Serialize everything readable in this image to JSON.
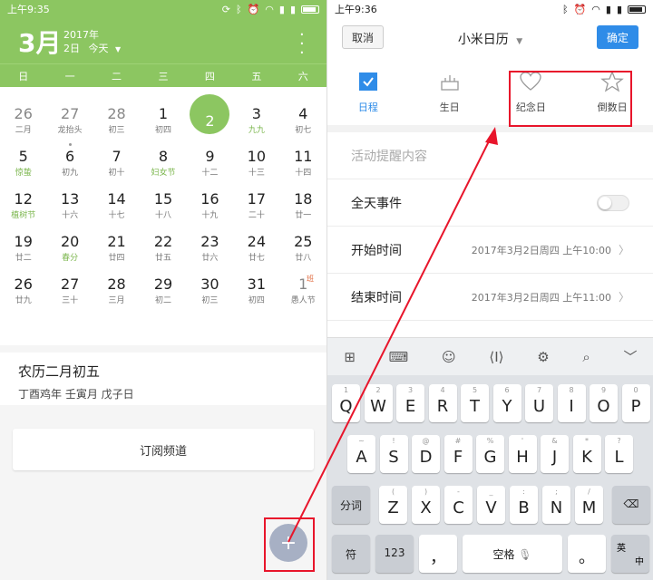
{
  "left": {
    "status": {
      "time": "上午9:35"
    },
    "header": {
      "month": "3月",
      "year": "2017年",
      "day": "2日",
      "today_label": "今天",
      "dropdown_icon": "triangle-down-icon",
      "menu_icon": "more-vertical-icon"
    },
    "weekdays": [
      "日",
      "一",
      "二",
      "三",
      "四",
      "五",
      "六"
    ],
    "days": [
      {
        "n": "26",
        "l": "二月",
        "dim": true
      },
      {
        "n": "27",
        "l": "龙抬头",
        "dim": true
      },
      {
        "n": "28",
        "l": "初三",
        "dim": true
      },
      {
        "n": "1",
        "l": "初四"
      },
      {
        "n": "2",
        "l": "",
        "sel": true
      },
      {
        "n": "3",
        "l": "九九",
        "g": true
      },
      {
        "n": "4",
        "l": "初七"
      },
      {
        "n": "5",
        "l": "惊蛰",
        "g": true
      },
      {
        "n": "6",
        "l": "初九",
        "dot": true
      },
      {
        "n": "7",
        "l": "初十"
      },
      {
        "n": "8",
        "l": "妇女节",
        "g": true
      },
      {
        "n": "9",
        "l": "十二"
      },
      {
        "n": "10",
        "l": "十三"
      },
      {
        "n": "11",
        "l": "十四"
      },
      {
        "n": "12",
        "l": "植树节",
        "g": true
      },
      {
        "n": "13",
        "l": "十六"
      },
      {
        "n": "14",
        "l": "十七"
      },
      {
        "n": "15",
        "l": "十八"
      },
      {
        "n": "16",
        "l": "十九"
      },
      {
        "n": "17",
        "l": "二十"
      },
      {
        "n": "18",
        "l": "廿一"
      },
      {
        "n": "19",
        "l": "廿二"
      },
      {
        "n": "20",
        "l": "春分",
        "g": true
      },
      {
        "n": "21",
        "l": "廿四"
      },
      {
        "n": "22",
        "l": "廿五"
      },
      {
        "n": "23",
        "l": "廿六"
      },
      {
        "n": "24",
        "l": "廿七"
      },
      {
        "n": "25",
        "l": "廿八"
      },
      {
        "n": "26",
        "l": "廿九"
      },
      {
        "n": "27",
        "l": "三十"
      },
      {
        "n": "28",
        "l": "三月"
      },
      {
        "n": "29",
        "l": "初二"
      },
      {
        "n": "30",
        "l": "初三"
      },
      {
        "n": "31",
        "l": "初四"
      },
      {
        "n": "1",
        "l": "愚人节",
        "dim": true,
        "ban": "班"
      }
    ],
    "lunar": {
      "title": "农历二月初五",
      "sub": "丁酉鸡年 壬寅月 戊子日"
    },
    "subscribe": "订阅频道",
    "fab": "+"
  },
  "right": {
    "status": {
      "time": "上午9:36"
    },
    "cancel": "取消",
    "title": "小米日历",
    "ok": "确定",
    "types": [
      {
        "label": "日程",
        "icon": "checkbox-checked-icon",
        "active": true
      },
      {
        "label": "生日",
        "icon": "cake-icon"
      },
      {
        "label": "纪念日",
        "icon": "heart-icon"
      },
      {
        "label": "倒数日",
        "icon": "star-icon"
      }
    ],
    "placeholder": "活动提醒内容",
    "allday": "全天事件",
    "start_label": "开始时间",
    "start_value": "2017年3月2日周四 上午10:00",
    "end_label": "结束时间",
    "end_value": "2017年3月2日周四 上午11:00",
    "kb_tools": [
      "grid-icon",
      "keyboard-icon",
      "emoji-icon",
      "cursor-icon",
      "settings-icon",
      "search-icon",
      "chevron-down-icon"
    ],
    "row1": [
      [
        "1",
        "Q"
      ],
      [
        "2",
        "W"
      ],
      [
        "3",
        "E"
      ],
      [
        "4",
        "R"
      ],
      [
        "5",
        "T"
      ],
      [
        "6",
        "Y"
      ],
      [
        "7",
        "U"
      ],
      [
        "8",
        "I"
      ],
      [
        "9",
        "O"
      ],
      [
        "0",
        "P"
      ]
    ],
    "row2": [
      [
        "~",
        "A"
      ],
      [
        "!",
        "S"
      ],
      [
        "@",
        "D"
      ],
      [
        "#",
        "F"
      ],
      [
        "%",
        "G"
      ],
      [
        "'",
        "H"
      ],
      [
        "&",
        "J"
      ],
      [
        "*",
        "K"
      ],
      [
        "?",
        "L"
      ]
    ],
    "row3": [
      [
        "(",
        "Z"
      ],
      [
        ")",
        "X"
      ],
      [
        "-",
        "C"
      ],
      [
        "_",
        "V"
      ],
      [
        ":",
        "B"
      ],
      [
        ";",
        "N"
      ],
      [
        "/",
        "M"
      ]
    ],
    "fn_fenci": "分词",
    "fn_fu": "符",
    "fn_123": "123",
    "fn_comma": "，",
    "fn_space": "空格",
    "fn_period": "。",
    "fn_lang_en": "英",
    "fn_lang_zh": "中"
  },
  "annotation_color": "#e8152b"
}
